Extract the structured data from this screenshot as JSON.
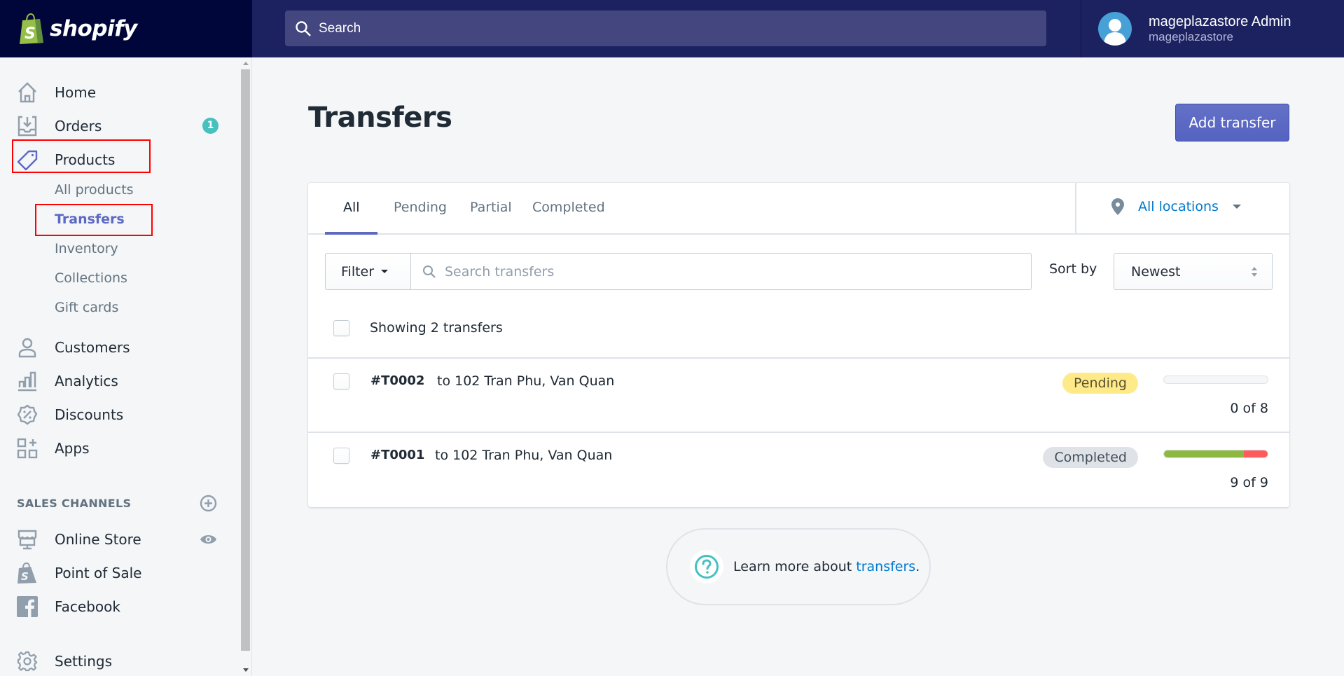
{
  "topbar": {
    "brand": "shopify",
    "search_placeholder": "Search",
    "user_name": "mageplazastore Admin",
    "store_name": "mageplazastore"
  },
  "sidebar": {
    "items": [
      {
        "label": "Home",
        "icon": "home-icon"
      },
      {
        "label": "Orders",
        "icon": "orders-icon",
        "badge": "1"
      },
      {
        "label": "Products",
        "icon": "tag-icon"
      },
      {
        "label": "Customers",
        "icon": "customer-icon"
      },
      {
        "label": "Analytics",
        "icon": "analytics-icon"
      },
      {
        "label": "Discounts",
        "icon": "discount-icon"
      },
      {
        "label": "Apps",
        "icon": "apps-icon"
      }
    ],
    "product_subitems": [
      {
        "label": "All products"
      },
      {
        "label": "Transfers",
        "active": true
      },
      {
        "label": "Inventory"
      },
      {
        "label": "Collections"
      },
      {
        "label": "Gift cards"
      }
    ],
    "sales_channels_title": "SALES CHANNELS",
    "channels": [
      {
        "label": "Online Store",
        "icon": "store-icon"
      },
      {
        "label": "Point of Sale",
        "icon": "pos-icon"
      },
      {
        "label": "Facebook",
        "icon": "facebook-icon"
      }
    ],
    "settings_label": "Settings"
  },
  "main": {
    "title": "Transfers",
    "add_button": "Add transfer",
    "tabs": [
      {
        "label": "All",
        "active": true
      },
      {
        "label": "Pending"
      },
      {
        "label": "Partial"
      },
      {
        "label": "Completed"
      }
    ],
    "location_filter": "All locations",
    "filter_label": "Filter",
    "search_placeholder": "Search transfers",
    "sort_label": "Sort by",
    "sort_value": "Newest",
    "showing_text": "Showing 2 transfers",
    "transfers": [
      {
        "id": "#T0002",
        "destination": "to 102 Tran Phu, Van Quan",
        "status": "Pending",
        "status_type": "pending",
        "received_fraction": 0,
        "rejected_fraction": 0,
        "count": "0 of 8"
      },
      {
        "id": "#T0001",
        "destination": "to 102 Tran Phu, Van Quan",
        "status": "Completed",
        "status_type": "completed",
        "received_fraction": 0.77,
        "rejected_fraction": 0.23,
        "count": "9 of 9"
      }
    ],
    "learn_more_prefix": "Learn more about ",
    "learn_more_link": "transfers",
    "learn_more_suffix": "."
  },
  "colors": {
    "topbar": "#1c2260",
    "logo_bg": "#000639",
    "accent": "#5c6ac4",
    "link": "#007ace",
    "badge": "#47c1bf",
    "pending": "#ffea8a",
    "progress_ok": "#8db943",
    "progress_rejected": "#fe5c5c"
  }
}
